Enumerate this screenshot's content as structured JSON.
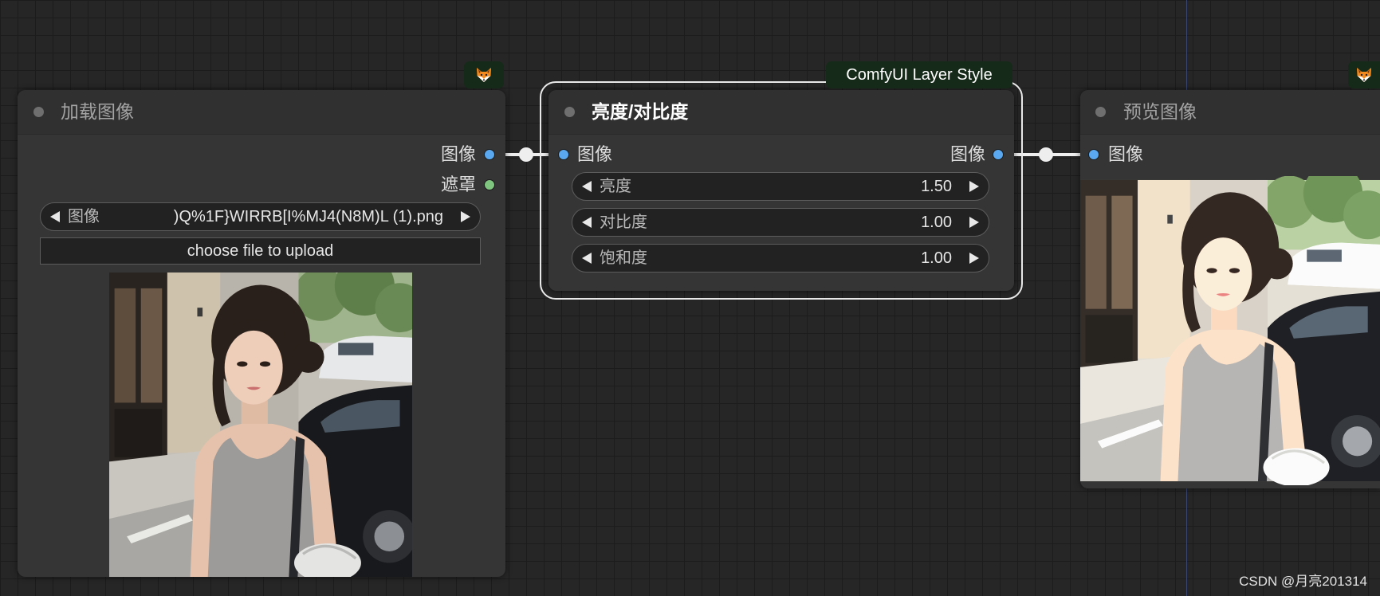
{
  "colors": {
    "link": "#eeeeee",
    "image_slot": "#5aa9f0",
    "mask_slot": "#7fc47f",
    "badge_bg": "#162a19"
  },
  "icons": {
    "node_badge": "fox-icon",
    "widget_left": "decrement-arrow-icon",
    "widget_right": "increment-arrow-icon",
    "header_status": "node-status-dot-icon"
  },
  "load_image_node": {
    "title": "加载图像",
    "outputs": [
      {
        "label": "图像"
      },
      {
        "label": "遮罩"
      }
    ],
    "combo": {
      "label": "图像",
      "value": ")Q%1F}WIRRB[I%MJ4(N8M)L (1).png"
    },
    "upload_button": "choose file to upload"
  },
  "group": {
    "title": "ComfyUI Layer Style"
  },
  "brightness_node": {
    "title": "亮度/对比度",
    "input_label": "图像",
    "output_label": "图像",
    "widgets": [
      {
        "label": "亮度",
        "value": "1.50"
      },
      {
        "label": "对比度",
        "value": "1.00"
      },
      {
        "label": "饱和度",
        "value": "1.00"
      }
    ]
  },
  "preview_node": {
    "title": "预览图像",
    "input_label": "图像"
  },
  "watermark": "CSDN @月亮201314"
}
